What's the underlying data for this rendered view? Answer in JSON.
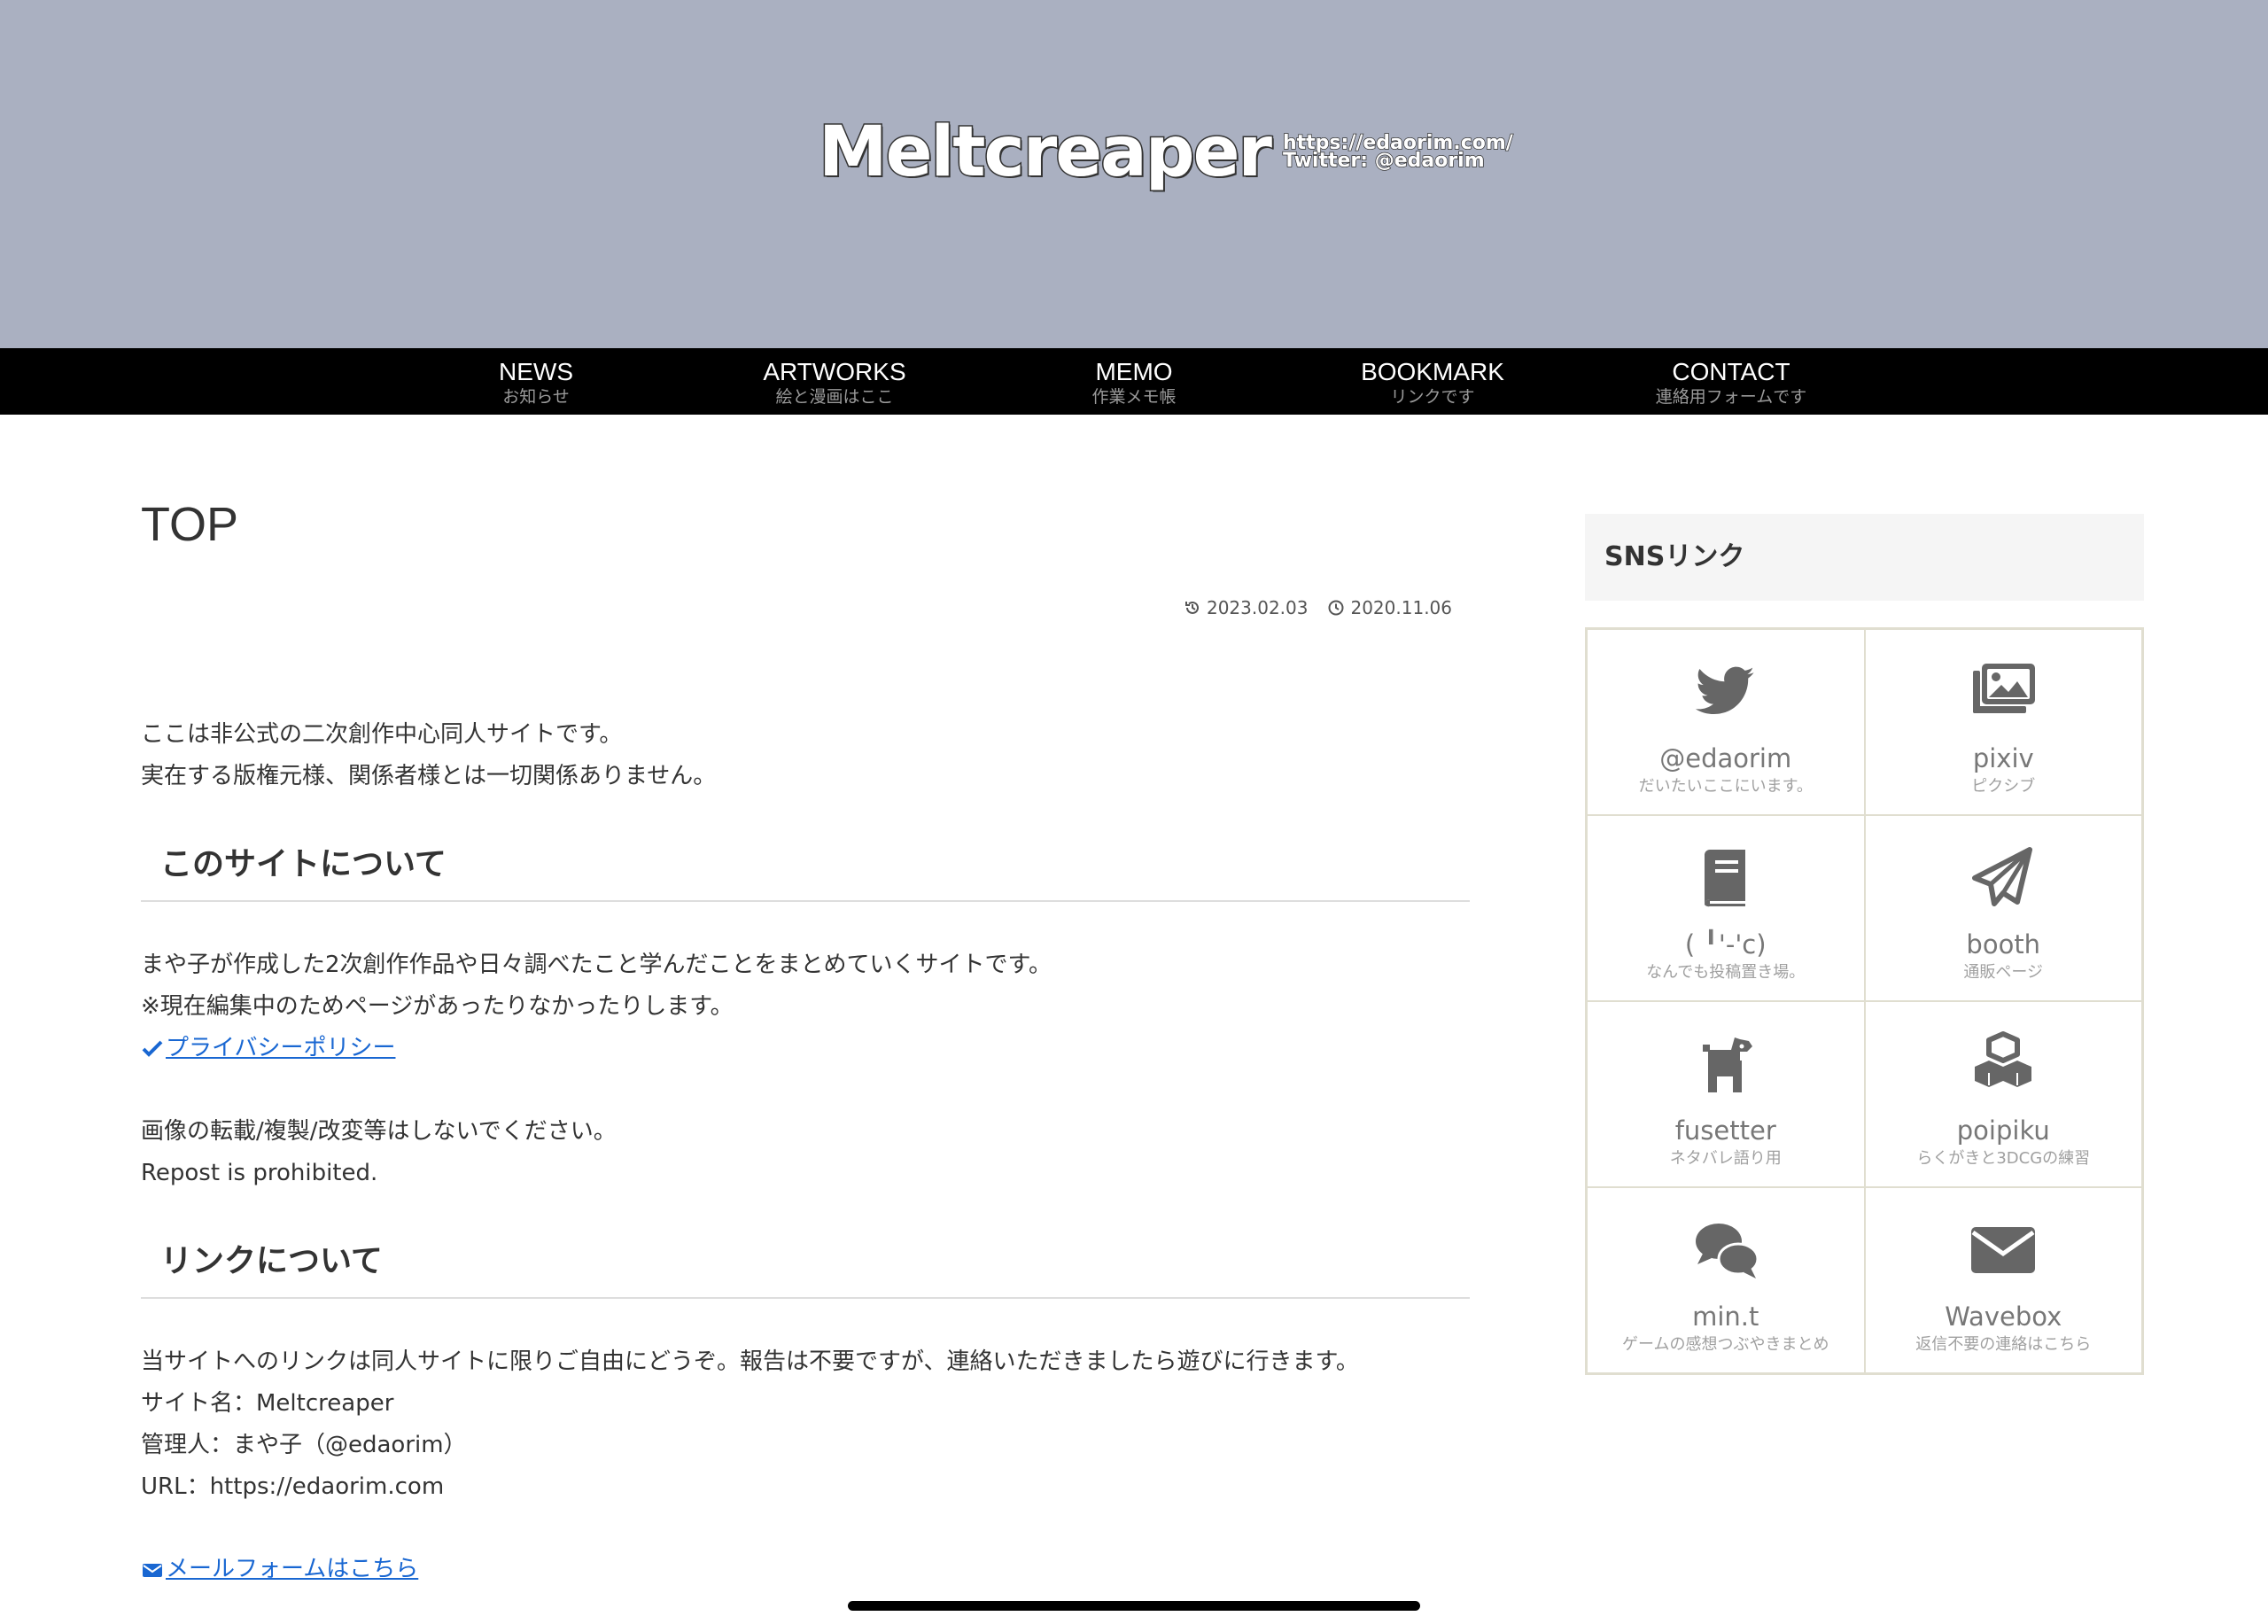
{
  "header": {
    "logo_main": "Meltcreaper",
    "logo_url": "https://edaorim.com/",
    "logo_twitter": "Twitter: @edaorim"
  },
  "nav": [
    {
      "label": "NEWS",
      "sub": "お知らせ"
    },
    {
      "label": "ARTWORKS",
      "sub": "絵と漫画はここ"
    },
    {
      "label": "MEMO",
      "sub": "作業メモ帳"
    },
    {
      "label": "BOOKMARK",
      "sub": "リンクです"
    },
    {
      "label": "CONTACT",
      "sub": "連絡用フォームです"
    }
  ],
  "page": {
    "title": "TOP",
    "updated": "2023.02.03",
    "published": "2020.11.06",
    "intro": [
      "ここは非公式の二次創作中心同人サイトです。",
      "実在する版権元様、関係者様とは一切関係ありません。"
    ],
    "section1_heading": "このサイトについて",
    "section1_lines": [
      "まや子が作成した2次創作作品や日々調べたこと学んだことをまとめていくサイトです。",
      "※現在編集中のためページがあったりなかったりします。"
    ],
    "privacy_link": "プライバシーポリシー",
    "notice_lines": [
      "画像の転載/複製/改変等はしないでください。",
      "Repost is prohibited."
    ],
    "section2_heading": "リンクについて",
    "section2_lines": [
      "当サイトへのリンクは同人サイトに限りご自由にどうぞ。報告は不要ですが、連絡いただきましたら遊びに行きます。",
      "サイト名：Meltcreaper",
      "管理人：まや子（@edaorim）",
      "URL：https://edaorim.com"
    ],
    "mail_link": "メールフォームはこちら"
  },
  "sidebar": {
    "title": "SNSリンク",
    "links": [
      {
        "name": "@edaorim",
        "desc": "だいたいここにいます。",
        "icon": "twitter-icon"
      },
      {
        "name": "pixiv",
        "desc": "ピクシブ",
        "icon": "images-icon"
      },
      {
        "name": "( ╹'-'c)",
        "desc": "なんでも投稿置き場。",
        "icon": "book-icon"
      },
      {
        "name": "booth",
        "desc": "通販ページ",
        "icon": "paper-plane-icon"
      },
      {
        "name": "fusetter",
        "desc": "ネタバレ語り用",
        "icon": "dog-icon"
      },
      {
        "name": "poipiku",
        "desc": "らくがきと3DCGの練習",
        "icon": "cubes-icon"
      },
      {
        "name": "min.t",
        "desc": "ゲームの感想つぶやきまとめ",
        "icon": "comments-icon"
      },
      {
        "name": "Wavebox",
        "desc": "返信不要の連絡はこちら",
        "icon": "envelope-icon"
      }
    ]
  },
  "colors": {
    "header_bg": "#aab0c1",
    "nav_bg": "#000000",
    "link": "#1967d2",
    "icon": "#666666"
  }
}
